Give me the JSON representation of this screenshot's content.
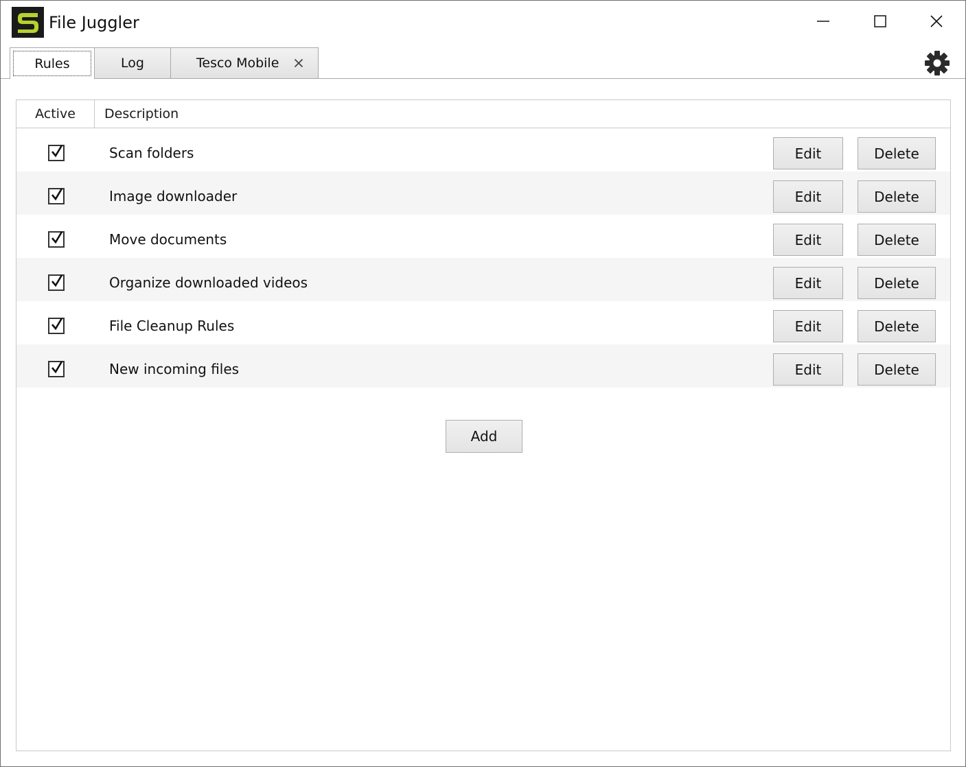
{
  "window": {
    "title": "File Juggler",
    "logo_letter": "S",
    "logo_color": "#b5d22e"
  },
  "tabs": [
    {
      "label": "Rules",
      "active": true
    },
    {
      "label": "Log",
      "active": false
    },
    {
      "label": "Tesco Mobile",
      "active": false,
      "closable": true
    }
  ],
  "table": {
    "headers": {
      "active": "Active",
      "description": "Description"
    },
    "rows": [
      {
        "active": true,
        "description": "Scan folders",
        "edit_label": "Edit",
        "delete_label": "Delete"
      },
      {
        "active": true,
        "description": "Image downloader",
        "edit_label": "Edit",
        "delete_label": "Delete"
      },
      {
        "active": true,
        "description": "Move documents",
        "edit_label": "Edit",
        "delete_label": "Delete"
      },
      {
        "active": true,
        "description": "Organize downloaded videos",
        "edit_label": "Edit",
        "delete_label": "Delete"
      },
      {
        "active": true,
        "description": "File Cleanup Rules",
        "edit_label": "Edit",
        "delete_label": "Delete"
      },
      {
        "active": true,
        "description": "New incoming files",
        "edit_label": "Edit",
        "delete_label": "Delete"
      }
    ]
  },
  "actions": {
    "add_label": "Add"
  },
  "icons": {
    "minimize": "minimize-icon",
    "maximize": "maximize-icon",
    "close": "close-icon",
    "tab_close": "close-icon",
    "settings": "gear-icon",
    "checkbox": "checkmark-icon"
  }
}
